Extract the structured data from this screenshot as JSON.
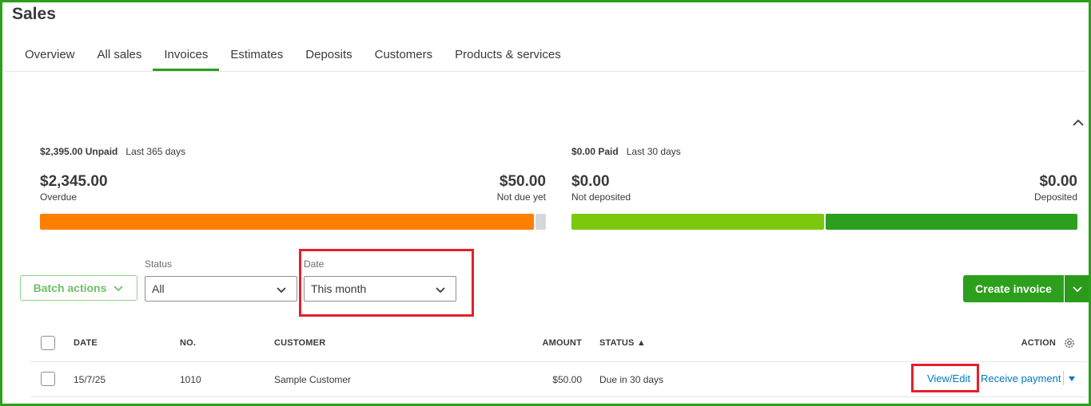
{
  "page": {
    "title": "Sales"
  },
  "tabs": [
    {
      "label": "Overview",
      "active": false
    },
    {
      "label": "All sales",
      "active": false
    },
    {
      "label": "Invoices",
      "active": true
    },
    {
      "label": "Estimates",
      "active": false
    },
    {
      "label": "Deposits",
      "active": false
    },
    {
      "label": "Customers",
      "active": false
    },
    {
      "label": "Products & services",
      "active": false
    }
  ],
  "summary": {
    "unpaid": {
      "headline": "$2,395.00 Unpaid",
      "period": "Last 365 days",
      "left_amount": "$2,345.00",
      "left_label": "Overdue",
      "right_amount": "$50.00",
      "right_label": "Not due yet",
      "bar_fractions": [
        0.979,
        0.021
      ],
      "bar_colors": [
        "#ff8000",
        "#d4d7dc"
      ]
    },
    "paid": {
      "headline": "$0.00 Paid",
      "period": "Last 30 days",
      "left_amount": "$0.00",
      "left_label": "Not deposited",
      "right_amount": "$0.00",
      "right_label": "Deposited",
      "bar_fractions": [
        0.5,
        0.5
      ],
      "bar_colors": [
        "#7ac70c",
        "#2ca01c"
      ]
    }
  },
  "filters": {
    "batch_actions_label": "Batch actions",
    "status_label": "Status",
    "status_value": "All",
    "date_label": "Date",
    "date_value": "This month"
  },
  "create_invoice_label": "Create invoice",
  "table": {
    "headers": {
      "date": "DATE",
      "no": "NO.",
      "customer": "CUSTOMER",
      "amount": "AMOUNT",
      "status": "STATUS ▲",
      "action": "ACTION"
    },
    "rows": [
      {
        "date": "15/7/25",
        "no": "1010",
        "customer": "Sample Customer",
        "amount": "$50.00",
        "status": "Due in 30 days",
        "view_edit": "View/Edit",
        "receive_payment": "Receive payment"
      }
    ]
  },
  "colors": {
    "brand_green": "#2ca01c",
    "highlight_red": "#e3202b",
    "link_blue": "#0077c5",
    "overdue_orange": "#ff8000"
  }
}
